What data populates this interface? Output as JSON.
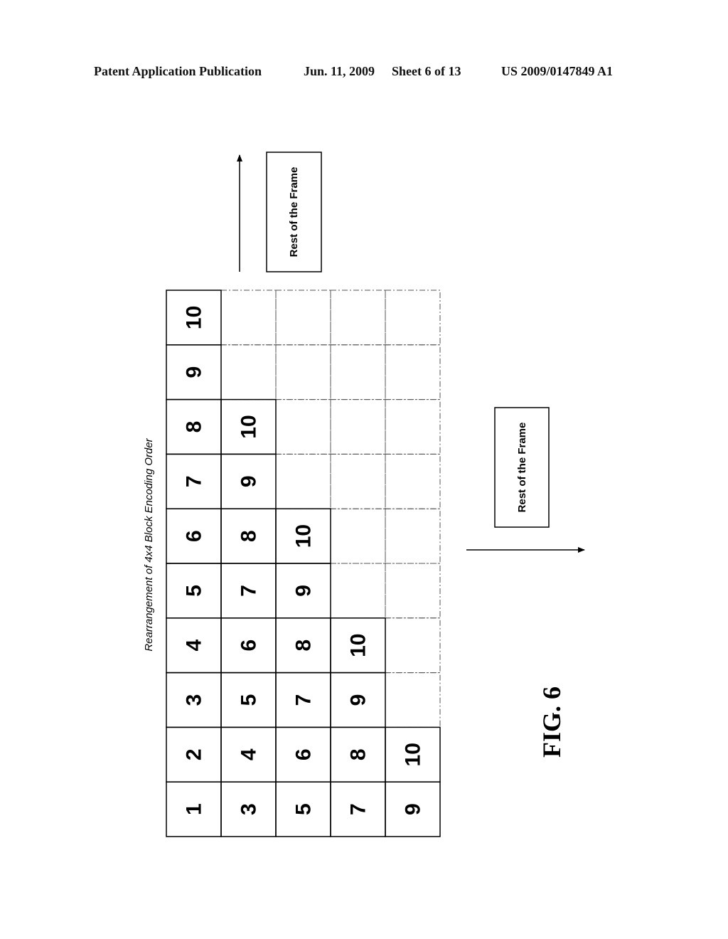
{
  "header": {
    "publication": "Patent Application Publication",
    "date": "Jun. 11, 2009",
    "sheet": "Sheet 6 of 13",
    "patent_number": "US 2009/0147849 A1"
  },
  "figure": {
    "title": "Rearrangement of 4x4 Block Encoding Order",
    "caption": "FIG. 6",
    "rest_label_top": "Rest of the Frame",
    "rest_label_right": "Rest of the Frame",
    "grid": {
      "rows": 5,
      "cols": 10,
      "max_order": 10,
      "cells": [
        [
          "1",
          "2",
          "3",
          "4",
          "5",
          "6",
          "7",
          "8",
          "9",
          "10"
        ],
        [
          "3",
          "4",
          "5",
          "6",
          "7",
          "8",
          "9",
          "10",
          "",
          ""
        ],
        [
          "5",
          "6",
          "7",
          "8",
          "9",
          "10",
          "",
          "",
          "",
          ""
        ],
        [
          "7",
          "8",
          "9",
          "10",
          "",
          "",
          "",
          "",
          "",
          ""
        ],
        [
          "9",
          "10",
          "",
          "",
          "",
          "",
          "",
          "",
          "",
          ""
        ]
      ]
    }
  }
}
